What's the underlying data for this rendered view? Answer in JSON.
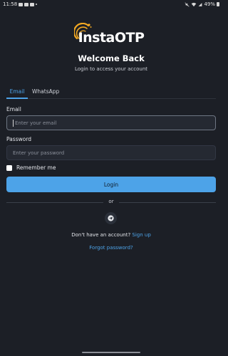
{
  "status_bar": {
    "time": "11:58",
    "battery": "49%",
    "icons": [
      "cloud-icon",
      "mail-icon",
      "message-icon",
      "dot-icon",
      "mute-icon",
      "wifi-icon",
      "signal-icon",
      "battery-icon"
    ]
  },
  "brand": {
    "logo_text": "InstaOTP",
    "accent_color": "#4da3e8",
    "logo_color": "#f2a822"
  },
  "header": {
    "title": "Welcome Back",
    "subtitle": "Login to access your account"
  },
  "tabs": [
    {
      "label": "Email",
      "active": true
    },
    {
      "label": "WhatsApp",
      "active": false
    }
  ],
  "form": {
    "email_label": "Email",
    "email_placeholder": "Enter your email",
    "email_value": "",
    "password_label": "Password",
    "password_placeholder": "Enter your password",
    "password_value": "",
    "remember_label": "Remember me",
    "remember_checked": false,
    "login_label": "Login"
  },
  "alt_login": {
    "divider_text": "or",
    "telegram_icon": "telegram-icon"
  },
  "footer": {
    "no_account_text": "Don't have an account?",
    "signup_label": "Sign up",
    "forgot_label": "Forgot password?"
  }
}
